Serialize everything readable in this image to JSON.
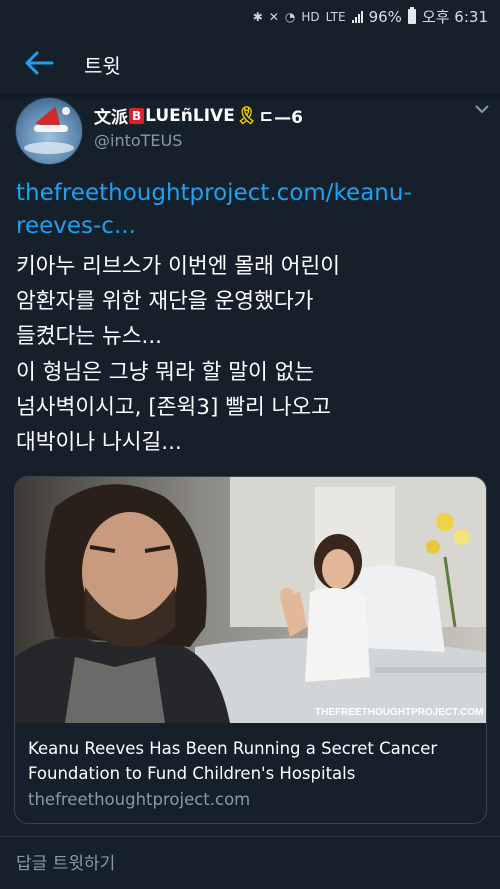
{
  "status_bar": {
    "battery": "96%",
    "time": "오후 6:31",
    "lte": "LTE",
    "hd": "HD"
  },
  "header": {
    "title": "트윗"
  },
  "tweet": {
    "display_name_prefix": "文派",
    "display_name_b": "B",
    "display_name_suffix": "LUEñLIVE",
    "display_name_end": "ㄷ—6",
    "handle": "@intoTEUS",
    "link_text": "thefreethoughtproject.com/keanu-reeves-c...",
    "text_lines": [
      "키아누 리브스가 이번엔 몰래 어린이",
      "암환자를 위한 재단을 운영했다가",
      "들켰다는 뉴스...",
      "이 형님은 그냥 뭐라 할 말이 없는",
      "넘사벽이시고, [존윅3] 빨리 나오고",
      "대박이나 나시길..."
    ]
  },
  "card": {
    "watermark": "THEFREETHOUGHTPROJECT.COM",
    "title": "Keanu Reeves Has Been Running a Secret Cancer Foundation to Fund Children's Hospitals",
    "domain": "thefreethoughtproject.com"
  },
  "reply": {
    "placeholder": "답글 트윗하기"
  },
  "colors": {
    "background": "#15202b",
    "link": "#1da1f2",
    "muted": "#8899a6"
  }
}
